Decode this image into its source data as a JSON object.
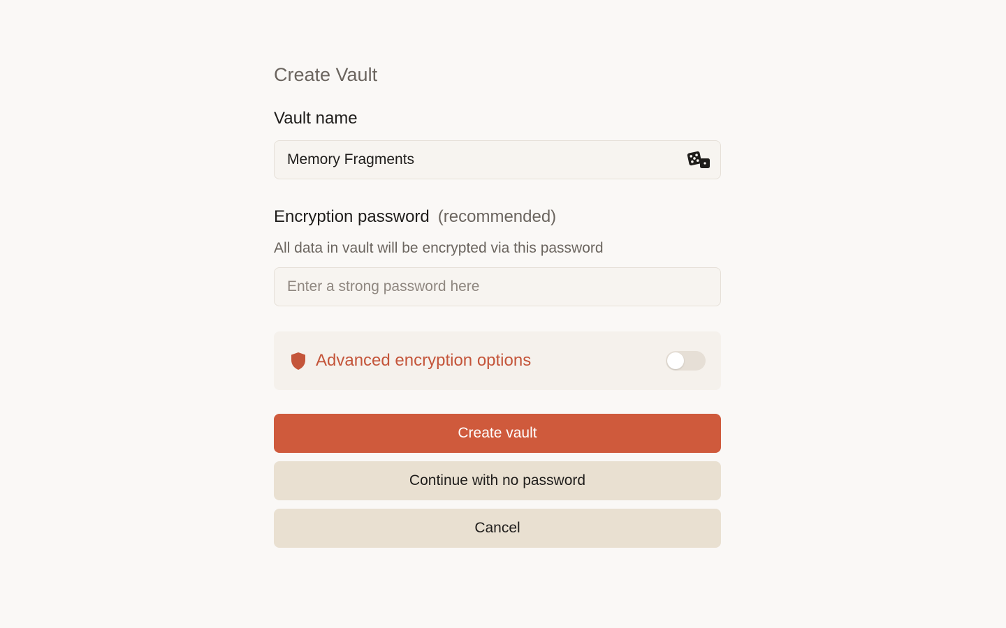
{
  "dialog": {
    "title": "Create Vault",
    "vault_name": {
      "label": "Vault name",
      "value": "Memory Fragments",
      "randomize_icon": "dice-icon"
    },
    "password": {
      "label": "Encryption password",
      "optional_note": "(recommended)",
      "hint": "All data in vault will be encrypted via this password",
      "placeholder": "Enter a strong password here",
      "value": ""
    },
    "advanced": {
      "icon": "shield-icon",
      "label": "Advanced encryption options",
      "enabled": false
    },
    "buttons": {
      "create": "Create vault",
      "no_password": "Continue with no password",
      "cancel": "Cancel"
    }
  },
  "colors": {
    "background": "#faf8f6",
    "accent": "#cf5a3c",
    "accent_text": "#c4553a",
    "secondary_button": "#e9e0d1",
    "field_background": "#f7f4f0",
    "muted_text": "#6b655f"
  }
}
